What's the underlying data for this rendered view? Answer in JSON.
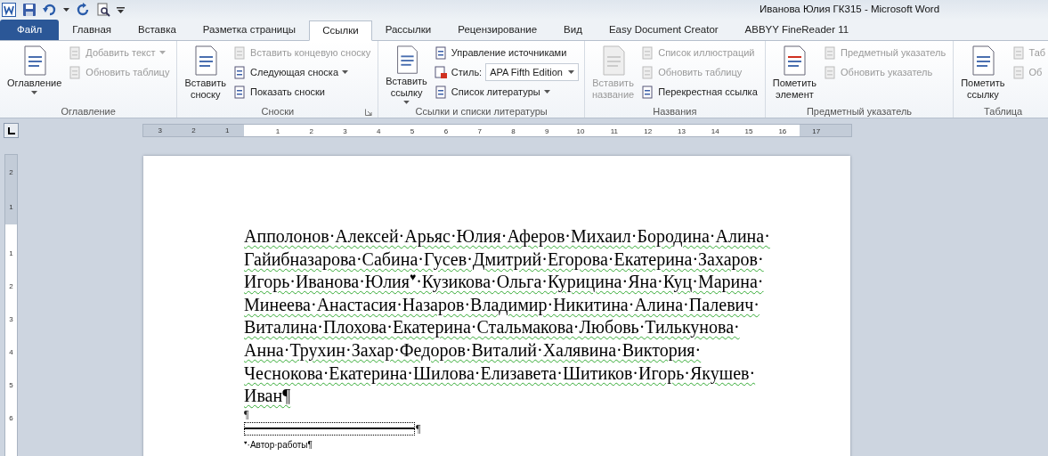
{
  "window": {
    "title": "Иванова Юлия ГК315  -  Microsoft Word"
  },
  "tabs": [
    {
      "label": "Файл",
      "kind": "file",
      "selected": false
    },
    {
      "label": "Главная",
      "kind": "tab",
      "selected": false
    },
    {
      "label": "Вставка",
      "kind": "tab",
      "selected": false
    },
    {
      "label": "Разметка страницы",
      "kind": "tab",
      "selected": false
    },
    {
      "label": "Ссылки",
      "kind": "tab",
      "selected": true
    },
    {
      "label": "Рассылки",
      "kind": "tab",
      "selected": false
    },
    {
      "label": "Рецензирование",
      "kind": "tab",
      "selected": false
    },
    {
      "label": "Вид",
      "kind": "tab",
      "selected": false
    },
    {
      "label": "Easy Document Creator",
      "kind": "tab",
      "selected": false
    },
    {
      "label": "ABBYY FineReader 11",
      "kind": "tab",
      "selected": false
    }
  ],
  "ribbon": {
    "groups": [
      {
        "label": "Оглавление",
        "launcher": false,
        "big": [
          {
            "label": "Оглавление",
            "disabled": false,
            "dropdown": true
          }
        ],
        "small": [
          {
            "kind": "button",
            "label": "Добавить текст",
            "disabled": true,
            "dropdown": true
          },
          {
            "kind": "button",
            "label": "Обновить таблицу",
            "disabled": true,
            "dropdown": false
          }
        ]
      },
      {
        "label": "Сноски",
        "launcher": true,
        "big": [
          {
            "label": "Вставить\nсноску",
            "disabled": false,
            "dropdown": false
          }
        ],
        "small": [
          {
            "kind": "button",
            "label": "Вставить концевую сноску",
            "disabled": true,
            "dropdown": false
          },
          {
            "kind": "button",
            "label": "Следующая сноска",
            "disabled": false,
            "dropdown": true
          },
          {
            "kind": "button",
            "label": "Показать сноски",
            "disabled": false,
            "dropdown": false
          }
        ]
      },
      {
        "label": "Ссылки и списки литературы",
        "launcher": false,
        "big": [
          {
            "label": "Вставить\nссылку",
            "disabled": false,
            "dropdown": true
          }
        ],
        "small": [
          {
            "kind": "button",
            "label": "Управление источниками",
            "disabled": false,
            "dropdown": false
          },
          {
            "kind": "combo",
            "label": "Стиль:",
            "value": "APA Fifth Edition",
            "disabled": false,
            "dropdown": true
          },
          {
            "kind": "button",
            "label": "Список литературы",
            "disabled": false,
            "dropdown": true
          }
        ]
      },
      {
        "label": "Названия",
        "launcher": false,
        "big": [
          {
            "label": "Вставить\nназвание",
            "disabled": true,
            "dropdown": false
          }
        ],
        "small": [
          {
            "kind": "button",
            "label": "Список иллюстраций",
            "disabled": true,
            "dropdown": false
          },
          {
            "kind": "button",
            "label": "Обновить таблицу",
            "disabled": true,
            "dropdown": false
          },
          {
            "kind": "button",
            "label": "Перекрестная ссылка",
            "disabled": false,
            "dropdown": false
          }
        ]
      },
      {
        "label": "Предметный указатель",
        "launcher": false,
        "big": [
          {
            "label": "Пометить\nэлемент",
            "disabled": false,
            "dropdown": false
          }
        ],
        "small": [
          {
            "kind": "button",
            "label": "Предметный указатель",
            "disabled": true,
            "dropdown": false
          },
          {
            "kind": "button",
            "label": "Обновить указатель",
            "disabled": true,
            "dropdown": false
          }
        ]
      },
      {
        "label": "Таблица",
        "launcher": false,
        "big": [
          {
            "label": "Пометить\nссылку",
            "disabled": false,
            "dropdown": false
          }
        ],
        "small": [
          {
            "kind": "button",
            "label": "Таб",
            "disabled": true,
            "dropdown": false
          },
          {
            "kind": "button",
            "label": "Об",
            "disabled": true,
            "dropdown": false
          }
        ]
      }
    ]
  },
  "ruler": {
    "left_numbers": [
      "3",
      "2",
      "1"
    ],
    "right_numbers": [
      "1",
      "2",
      "3",
      "4",
      "5",
      "6",
      "7",
      "8",
      "9",
      "10",
      "11",
      "12",
      "13",
      "14",
      "15",
      "16",
      "17"
    ]
  },
  "vertical_ruler": {
    "top_numbers": [
      "2",
      "1"
    ],
    "numbers": [
      "1",
      "2",
      "3",
      "4",
      "5",
      "6"
    ]
  },
  "document": {
    "body_lines": [
      "Апполонов·Алексей·Арьяс·Юлия·Аферов·Михаил·Бородина·Алина·",
      "Гайибназарова·Сабина·Гусев·Дмитрий·Егорова·Екатерина·Захаров·",
      "Игорь·Иванова·Юлия$^{♥}$·Кузикова·Ольга·Курицина·Яна·Куц·Марина·",
      "Минеева·Анастасия·Назаров·Владимир·Никитина·Алина·Палевич·",
      "Виталина·Плохова·Екатерина·Стальмакова·Любовь·Тилькунова·",
      "Анна·Трухин·Захар·Федоров·Виталий·Халявина·Виктория·",
      "Чеснокова·Екатерина·Шилова·Елизавета·Шитиков·Игорь·Якушев·",
      "Иван¶"
    ],
    "empty_paragraph": "¶",
    "separator_mark": "¶",
    "footnote": "$^{♥}$·Автор·работы¶"
  }
}
